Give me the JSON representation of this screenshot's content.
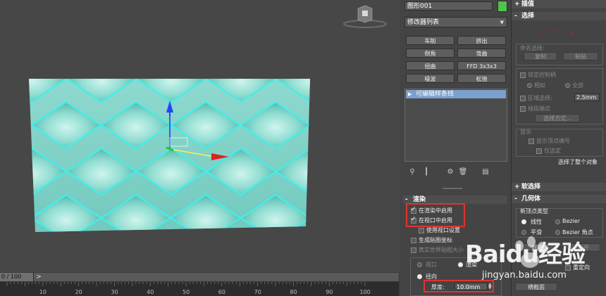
{
  "viewport": {
    "label": "Perspective viewport with shape object"
  },
  "timeline": {
    "frame_display": "0 / 100",
    "next_label": ">",
    "ticks": [
      "10",
      "20",
      "30",
      "40",
      "50",
      "60",
      "70",
      "80",
      "90",
      "100"
    ]
  },
  "modify_panel": {
    "object_name": "图形001",
    "object_color": "#52c24a",
    "modifier_list": "修改器列表",
    "buttons": [
      "车削",
      "挤出",
      "倒角",
      "弯曲",
      "扭曲",
      "FFD 3x3x3",
      "噪波",
      "松弛"
    ],
    "stack_item": "可编辑样条线",
    "stack_tools": [
      "pin-icon",
      "show-end-result-icon",
      "make-unique-icon",
      "remove-modifier-icon",
      "configure-sets-icon"
    ]
  },
  "rendering": {
    "title": "渲染",
    "enable_in_renderer": "在渲染中启用",
    "enable_in_viewport": "在视口中启用",
    "use_viewport_settings": "使用视口设置",
    "generate_mapping": "生成贴图坐标",
    "real_world_map_size": "真实世界贴图大小",
    "viewport_radio": "视口",
    "renderer_radio": "渲染",
    "radial_radio": "径向",
    "thickness_label": "厚度:",
    "thickness_value": "10.0mm",
    "apply_button": "横截面",
    "enable_in_renderer_checked": true,
    "enable_in_viewport_checked": true
  },
  "right_panel": {
    "interpolation": "插值",
    "selection": "选择",
    "named_selection": "命名选择:",
    "copy": "复制",
    "paste": "粘贴",
    "lock_handles": "锁定控制柄",
    "similar": "相似",
    "all": "全部",
    "area_selection": "区域选择:",
    "area_value": "2.5mm",
    "segment_end": "线段端点",
    "select_by": "选择方式...",
    "display": "显示",
    "show_vertex_numbers": "显示顶点编号",
    "only_selected": "仅选定",
    "selected_status": "选择了整个对象",
    "soft_selection": "软选择",
    "geometry": "几何体",
    "new_vertex_type": "新顶点类型",
    "linear": "线性",
    "bezier": "Bezier",
    "smooth": "平滑",
    "bezier_corner": "Bezier 角点",
    "create_line": "创建线",
    "break": "断开",
    "reorient": "重定向"
  },
  "watermark": {
    "brand": "Baidu经验",
    "url": "jingyan.baidu.com"
  }
}
